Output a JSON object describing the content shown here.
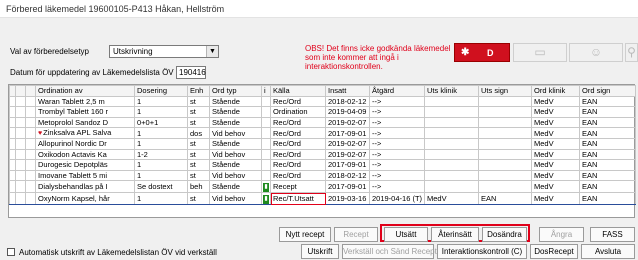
{
  "window": {
    "title": "Förbered läkemedel  19600105-P413 Håkan, Hellström"
  },
  "form": {
    "type_label": "Val av förberedelsetyp",
    "type_value": "Utskrivning",
    "date_label": "Datum för uppdatering av Läkemedelslista ÖV",
    "date_value": "190416"
  },
  "warning": "OBS! Det finns icke godkända läkemedel som inte kommer att ingå i interaktionskontrollen.",
  "d_button": {
    "label": "D",
    "icon": "star-icon"
  },
  "icon_buttons": [
    "tablet-icon",
    "person-icon",
    "walking-person-icon"
  ],
  "columns": [
    "",
    "",
    "",
    "Ordination av",
    "Dosering",
    "Enh",
    "Ord typ",
    "i",
    "Källa",
    "Insatt",
    "Åtgärd",
    "Uts klinik",
    "Uts sign",
    "Ord klinik",
    "Ord sign"
  ],
  "rows": [
    {
      "name": "Waran Tablett 2,5 m",
      "dose": "1",
      "unit": "st",
      "type": "Stående",
      "info": "",
      "source": "Rec/Ord",
      "start": "2018-02-12",
      "action": "-->",
      "uts_clinic": "",
      "uts_sign": "",
      "ord_clinic": "MedV",
      "ord_sign": "EAN"
    },
    {
      "name": "Trombyl Tablett 160 r",
      "dose": "1",
      "unit": "st",
      "type": "Stående",
      "info": "",
      "source": "Ordination",
      "start": "2019-04-09",
      "action": "-->",
      "uts_clinic": "",
      "uts_sign": "",
      "ord_clinic": "MedV",
      "ord_sign": "EAN"
    },
    {
      "name": "Metoprolol Sandoz D",
      "dose": "0+0+1",
      "unit": "st",
      "type": "Stående",
      "info": "",
      "source": "Rec/Ord",
      "start": "2019-02-07",
      "action": "-->",
      "uts_clinic": "",
      "uts_sign": "",
      "ord_clinic": "MedV",
      "ord_sign": "EAN"
    },
    {
      "name": "Zinksalva APL Salva",
      "dose": "1",
      "unit": "dos",
      "type": "Vid behov",
      "info": "",
      "source": "Rec/Ord",
      "start": "2017-09-01",
      "action": "-->",
      "uts_clinic": "",
      "uts_sign": "",
      "ord_clinic": "MedV",
      "ord_sign": "EAN",
      "flag": "heart"
    },
    {
      "name": "Allopurinol Nordic Dr",
      "dose": "1",
      "unit": "st",
      "type": "Stående",
      "info": "",
      "source": "Rec/Ord",
      "start": "2019-02-07",
      "action": "-->",
      "uts_clinic": "",
      "uts_sign": "",
      "ord_clinic": "MedV",
      "ord_sign": "EAN"
    },
    {
      "name": "Oxikodon Actavis Ka",
      "dose": "1-2",
      "unit": "st",
      "type": "Vid behov",
      "info": "",
      "source": "Rec/Ord",
      "start": "2019-02-07",
      "action": "-->",
      "uts_clinic": "",
      "uts_sign": "",
      "ord_clinic": "MedV",
      "ord_sign": "EAN"
    },
    {
      "name": "Durogesic Depotpläs",
      "dose": "1",
      "unit": "st",
      "type": "Stående",
      "info": "",
      "source": "Rec/Ord",
      "start": "2017-09-01",
      "action": "-->",
      "uts_clinic": "",
      "uts_sign": "",
      "ord_clinic": "MedV",
      "ord_sign": "EAN"
    },
    {
      "name": "Imovane Tablett 5 mi",
      "dose": "1",
      "unit": "st",
      "type": "Vid behov",
      "info": "",
      "source": "Rec/Ord",
      "start": "2018-02-12",
      "action": "-->",
      "uts_clinic": "",
      "uts_sign": "",
      "ord_clinic": "MedV",
      "ord_sign": "EAN"
    },
    {
      "name": "Dialysbehandlas på I",
      "dose": "Se dostext",
      "unit": "beh",
      "type": "Stående",
      "info": "green",
      "source": "Recept",
      "start": "2017-09-01",
      "action": "-->",
      "uts_clinic": "",
      "uts_sign": "",
      "ord_clinic": "MedV",
      "ord_sign": "EAN"
    },
    {
      "name": "OxyNorm Kapsel, hår",
      "dose": "1",
      "unit": "st",
      "type": "Vid behov",
      "info": "green",
      "source": "Rec/T.Utsatt",
      "start": "2019-03-16",
      "action": "2019-04-16 (T)",
      "uts_clinic": "MedV",
      "uts_sign": "EAN",
      "ord_clinic": "MedV",
      "ord_sign": "EAN",
      "selected": true
    }
  ],
  "buttons": {
    "new_recipe": "Nytt recept",
    "recipe": "Recept",
    "utsatt": "Utsätt",
    "ateruinsatt": "Återinsätt",
    "dosandra": "Dosändra",
    "angra": "Ångra",
    "fass": "FASS",
    "utskrift": "Utskrift",
    "verkstall": "Verkställ och Sänd Recept",
    "interaktion": "Interaktionskontroll (C)",
    "dosrecept": "DosRecept",
    "avsluta": "Avsluta"
  },
  "auto_print_label": "Automatisk utskrift av Läkemedelslistan ÖV vid verkställ",
  "auto_print_checked": false
}
